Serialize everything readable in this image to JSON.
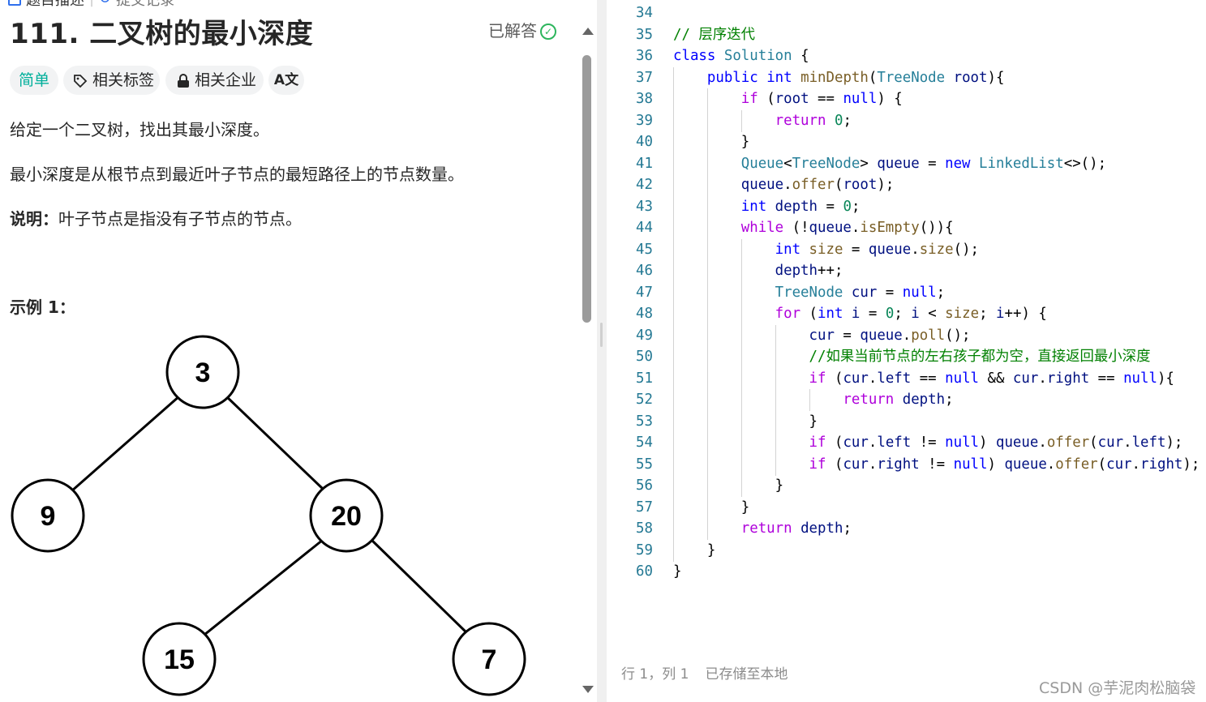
{
  "tabs": [
    {
      "label": "题目描述",
      "icon": "description-icon"
    },
    {
      "label": "提交记录",
      "icon": "history-icon"
    }
  ],
  "problem": {
    "title": "111. 二叉树的最小深度",
    "status": "已解答",
    "status_icon": "check-circle-icon",
    "tags": {
      "difficulty": "简单",
      "topics": "相关标签",
      "companies": "相关企业",
      "translate": "A文"
    },
    "description": [
      "给定一个二叉树，找出其最小深度。",
      "最小深度是从根节点到最近叶子节点的最短路径上的节点数量。"
    ],
    "note_label": "说明：",
    "note_text": "叶子节点是指没有子节点的节点。",
    "example_title": "示例 1：",
    "tree_nodes": [
      "3",
      "9",
      "20",
      "15",
      "7"
    ]
  },
  "editor": {
    "lines": [
      {
        "n": "34",
        "t": ""
      },
      {
        "n": "35",
        "t": "// 层序迭代"
      },
      {
        "n": "36",
        "t": "class Solution {"
      },
      {
        "n": "37",
        "t": "    public int minDepth(TreeNode root){"
      },
      {
        "n": "38",
        "t": "        if (root == null) {"
      },
      {
        "n": "39",
        "t": "            return 0;"
      },
      {
        "n": "40",
        "t": "        }"
      },
      {
        "n": "41",
        "t": "        Queue<TreeNode> queue = new LinkedList<>();"
      },
      {
        "n": "42",
        "t": "        queue.offer(root);"
      },
      {
        "n": "43",
        "t": "        int depth = 0;"
      },
      {
        "n": "44",
        "t": "        while (!queue.isEmpty()){"
      },
      {
        "n": "45",
        "t": "            int size = queue.size();"
      },
      {
        "n": "46",
        "t": "            depth++;"
      },
      {
        "n": "47",
        "t": "            TreeNode cur = null;"
      },
      {
        "n": "48",
        "t": "            for (int i = 0; i < size; i++) {"
      },
      {
        "n": "49",
        "t": "                cur = queue.poll();"
      },
      {
        "n": "50",
        "t": "                //如果当前节点的左右孩子都为空，直接返回最小深度"
      },
      {
        "n": "51",
        "t": "                if (cur.left == null && cur.right == null){"
      },
      {
        "n": "52",
        "t": "                    return depth;"
      },
      {
        "n": "53",
        "t": "                }"
      },
      {
        "n": "54",
        "t": "                if (cur.left != null) queue.offer(cur.left);"
      },
      {
        "n": "55",
        "t": "                if (cur.right != null) queue.offer(cur.right);"
      },
      {
        "n": "56",
        "t": "            }"
      },
      {
        "n": "57",
        "t": "        }"
      },
      {
        "n": "58",
        "t": "        return depth;"
      },
      {
        "n": "59",
        "t": "    }"
      },
      {
        "n": "60",
        "t": "}"
      }
    ],
    "status_position": "行 1，列 1",
    "status_saved": "已存储至本地"
  },
  "watermark": "CSDN @芋泥肉松脑袋",
  "colors": {
    "keyword": "#0000ff",
    "type": "#267f99",
    "function": "#795e26",
    "number": "#098658",
    "comment": "#008000",
    "control": "#af00db",
    "line_number": "#237893",
    "difficulty_easy": "#00af9b",
    "solved_check": "#2db55d"
  }
}
